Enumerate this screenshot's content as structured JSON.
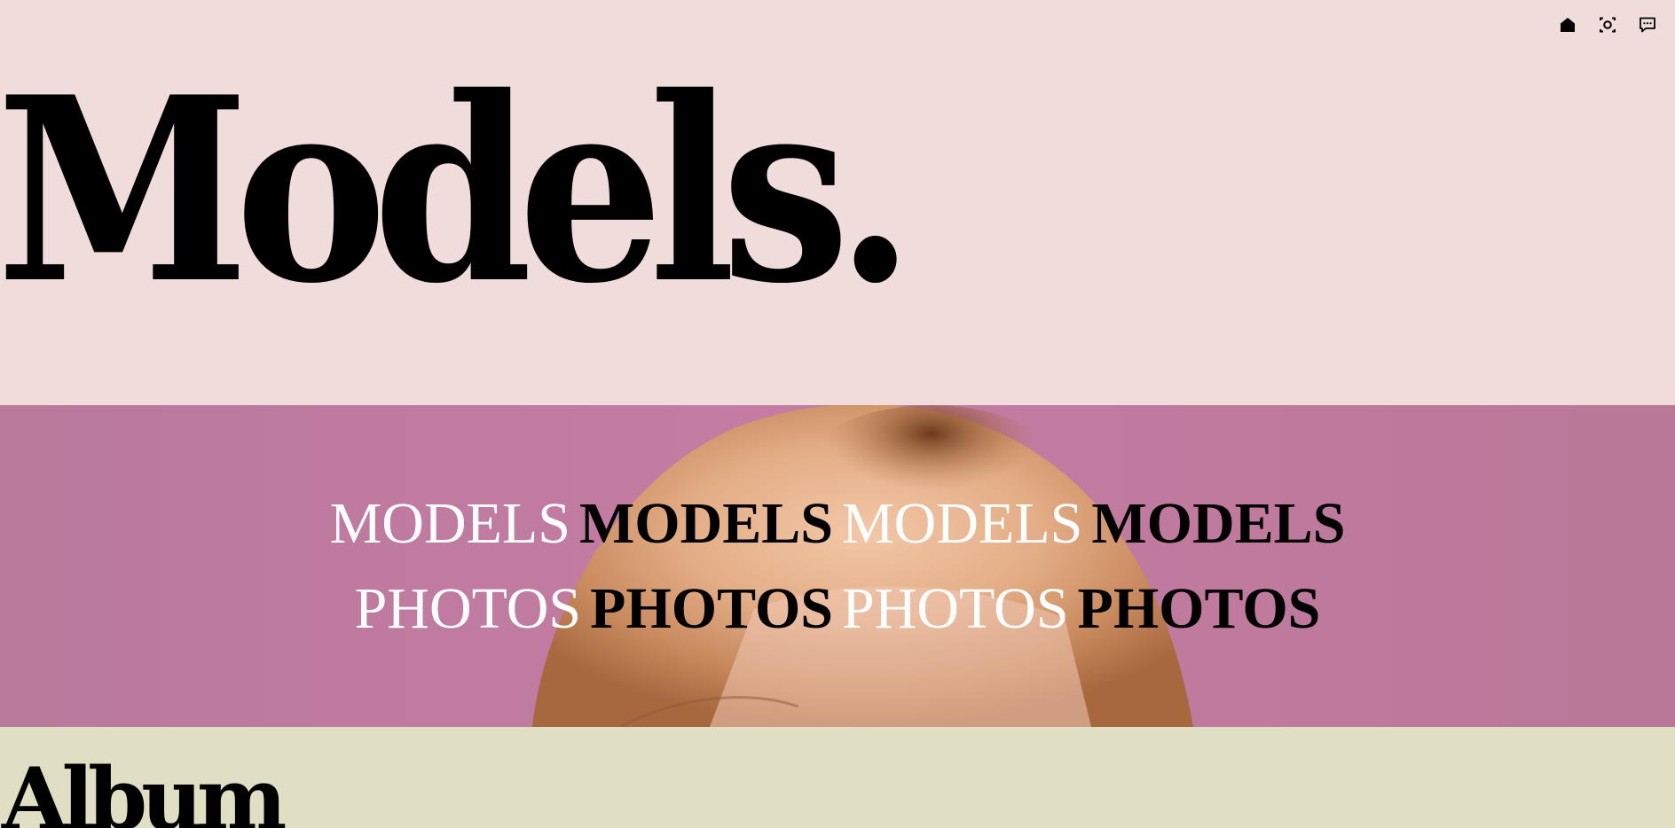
{
  "nav": {
    "items": [
      {
        "icon": "home-icon"
      },
      {
        "icon": "camera-icon"
      },
      {
        "icon": "chat-icon"
      }
    ]
  },
  "hero": {
    "title": "Models."
  },
  "band": {
    "row1": [
      "MODELS",
      "MODELS",
      "MODELS",
      "MODELS"
    ],
    "row2": [
      "PHOTOS",
      "PHOTOS",
      "PHOTOS",
      "PHOTOS"
    ]
  },
  "album": {
    "title": "Album"
  },
  "colors": {
    "top_bg": "#f1dcdc",
    "band_bg": "#c17aa2",
    "album_bg": "#e0dfc3",
    "text_dark": "#000000",
    "text_light": "#ffffff"
  }
}
